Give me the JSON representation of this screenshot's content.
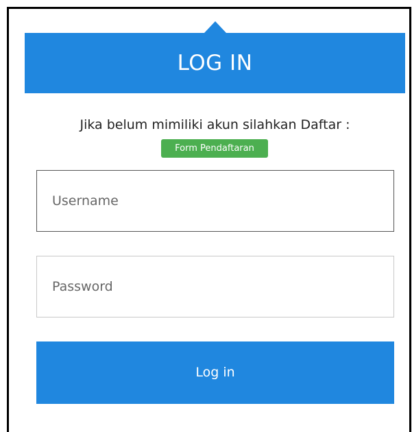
{
  "header": {
    "title": "LOG IN"
  },
  "register": {
    "prompt": "Jika belum mimiliki akun silahkan Daftar :",
    "button_label": "Form Pendaftaran"
  },
  "form": {
    "username_placeholder": "Username",
    "password_placeholder": "Password",
    "submit_label": "Log in"
  },
  "colors": {
    "primary": "#2087df",
    "register_button": "#4caf50"
  }
}
